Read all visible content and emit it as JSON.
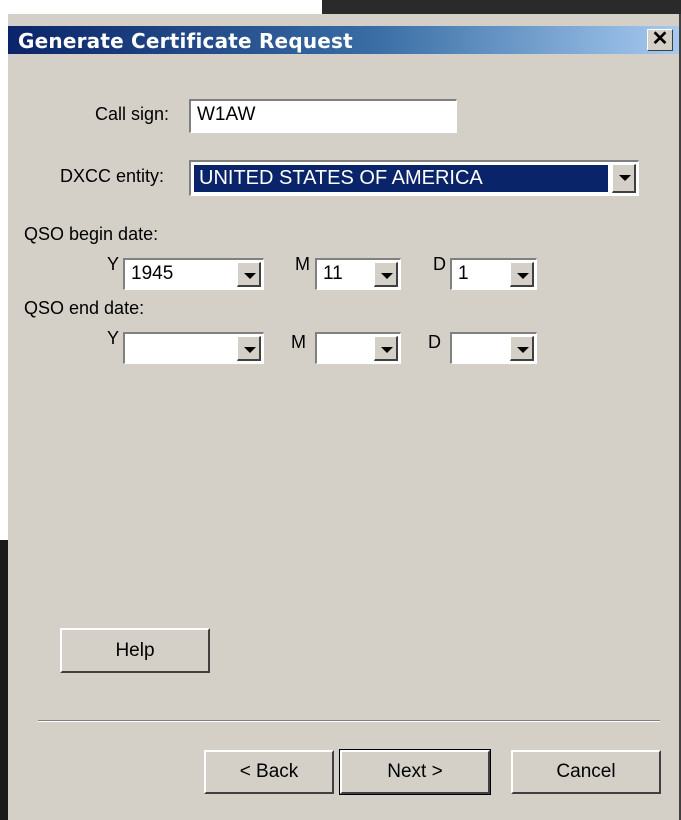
{
  "dialog": {
    "title": "Generate Certificate Request",
    "close_label": "✕"
  },
  "call_sign": {
    "label": "Call sign:",
    "value": "W1AW"
  },
  "dxcc": {
    "label": "DXCC entity:",
    "value": "UNITED STATES OF AMERICA"
  },
  "qso_begin": {
    "label": "QSO begin date:",
    "y_label": "Y",
    "m_label": "M",
    "d_label": "D",
    "year": "1945",
    "month": "11",
    "day": "1"
  },
  "qso_end": {
    "label": "QSO end date:",
    "y_label": "Y",
    "m_label": "M",
    "d_label": "D",
    "year": "",
    "month": "",
    "day": ""
  },
  "buttons": {
    "help": "Help",
    "back": "< Back",
    "next": "Next >",
    "cancel": "Cancel"
  },
  "colors": {
    "face": "#d4d0c8",
    "titlebar_start": "#0a246a",
    "titlebar_end": "#a6caf0",
    "selection": "#0a246a"
  }
}
